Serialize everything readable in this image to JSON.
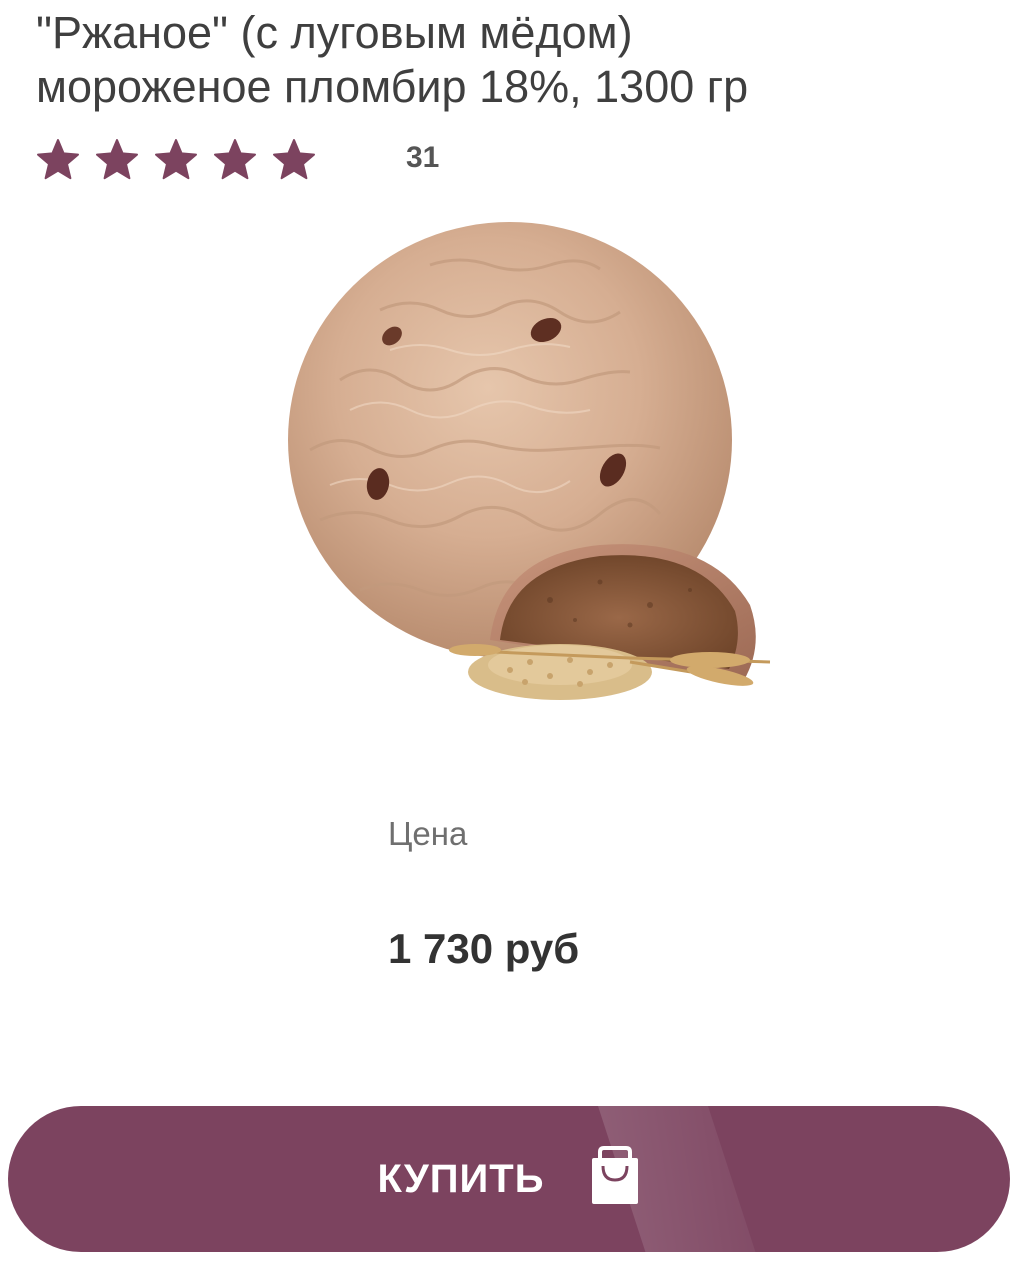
{
  "product": {
    "title_line1": "\"Ржаное\" (с луговым мёдом)",
    "title_line2": "мороженое пломбир 18%, 1300 гр",
    "rating": {
      "stars": 5,
      "max_stars": 5,
      "count": "31",
      "star_color": "#7c435f"
    },
    "image_icon": "ice-cream-scoop-with-rye-bread-and-wheat"
  },
  "price": {
    "label": "Цена",
    "value": "1 730 руб"
  },
  "buy_button": {
    "label": "КУПИТЬ",
    "icon": "shopping-bag-icon",
    "color": "#7c435f"
  }
}
